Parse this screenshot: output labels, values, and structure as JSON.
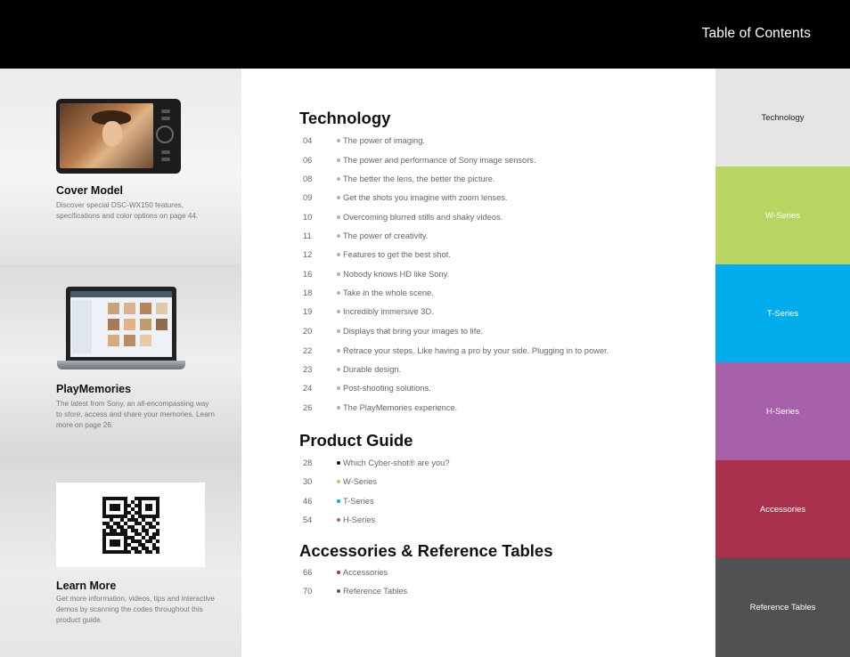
{
  "header": {
    "title": "Table of Contents"
  },
  "sidebar": {
    "cover": {
      "title": "Cover Model",
      "desc": "Discover special DSC-WX150 features, specifications and color options on page 44."
    },
    "playmemories": {
      "title": "PlayMemories",
      "desc": "The latest from Sony, an all-encompassing way to store, access and share your memories. Learn more on page 26."
    },
    "learn": {
      "title": "Learn More",
      "desc": "Get more information, videos, tips and interactive demos by scanning the codes throughout this product guide."
    }
  },
  "sections": [
    {
      "title": "Technology",
      "items": [
        {
          "page": "04",
          "text": "The power of imaging."
        },
        {
          "page": "06",
          "text": "The power and performance of Sony image sensors."
        },
        {
          "page": "08",
          "text": "The better the lens, the better the picture."
        },
        {
          "page": "09",
          "text": "Get the shots you imagine with zoom lenses."
        },
        {
          "page": "10",
          "text": "Overcoming blurred stills and shaky videos."
        },
        {
          "page": "11",
          "text": "The power of creativity."
        },
        {
          "page": "12",
          "text": "Features to get the best shot."
        },
        {
          "page": "16",
          "text": "Nobody knows HD like Sony."
        },
        {
          "page": "18",
          "text": "Take in the whole scene."
        },
        {
          "page": "19",
          "text": "Incredibly immersive 3D."
        },
        {
          "page": "20",
          "text": "Displays that bring your images to life."
        },
        {
          "page": "22",
          "text": "Retrace your steps. Like having a pro by your side. Plugging in to power."
        },
        {
          "page": "23",
          "text": "Durable design."
        },
        {
          "page": "24",
          "text": "Post-shooting solutions."
        },
        {
          "page": "26",
          "text": "The PlayMemories experience."
        }
      ]
    },
    {
      "title": "Product Guide",
      "items": [
        {
          "page": "28",
          "text": "Which Cyber-shot® are you?",
          "dot_color": "#111111"
        },
        {
          "page": "30",
          "text": "W-Series",
          "dot_color": "#b5d45c"
        },
        {
          "page": "46",
          "text": "T-Series",
          "dot_color": "#00aee8"
        },
        {
          "page": "54",
          "text": "H-Series",
          "dot_color": "#a55fa8"
        }
      ]
    },
    {
      "title": "Accessories & Reference Tables",
      "items": [
        {
          "page": "66",
          "text": "Accessories",
          "dot_color": "#a8304a"
        },
        {
          "page": "70",
          "text": "Reference Tables",
          "dot_color": "#555555"
        }
      ]
    }
  ],
  "tabs": [
    {
      "label": "Technology",
      "bg": "#e5e5e5",
      "fg": "#222222"
    },
    {
      "label": "W-Series",
      "bg": "#b9d663",
      "fg": "#ffffff"
    },
    {
      "label": "T-Series",
      "bg": "#00acec",
      "fg": "#ffffff"
    },
    {
      "label": "H-Series",
      "bg": "#a760aa",
      "fg": "#ffffff"
    },
    {
      "label": "Accessories",
      "bg": "#a8304a",
      "fg": "#ffffff"
    },
    {
      "label": "Reference Tables",
      "bg": "#505153",
      "fg": "#ffffff"
    }
  ]
}
